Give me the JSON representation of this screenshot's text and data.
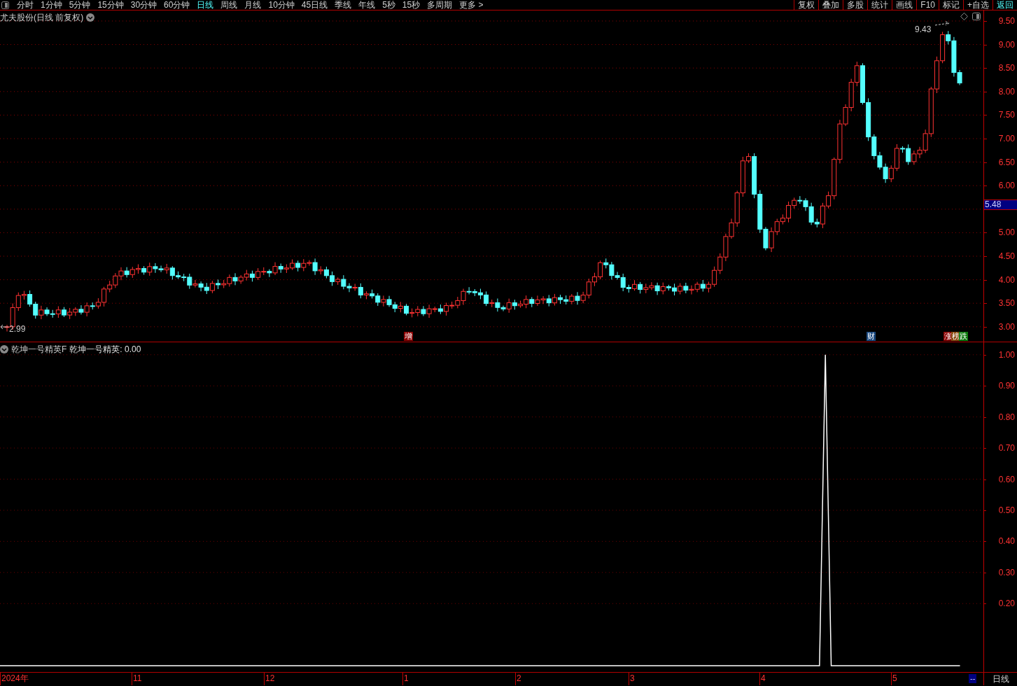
{
  "toolbar": {
    "periods": [
      {
        "label": "分时",
        "selected": false
      },
      {
        "label": "1分钟",
        "selected": false
      },
      {
        "label": "5分钟",
        "selected": false
      },
      {
        "label": "15分钟",
        "selected": false
      },
      {
        "label": "30分钟",
        "selected": false
      },
      {
        "label": "60分钟",
        "selected": false
      },
      {
        "label": "日线",
        "selected": true
      },
      {
        "label": "周线",
        "selected": false
      },
      {
        "label": "月线",
        "selected": false
      },
      {
        "label": "10分钟",
        "selected": false
      },
      {
        "label": "45日线",
        "selected": false
      },
      {
        "label": "季线",
        "selected": false
      },
      {
        "label": "年线",
        "selected": false
      },
      {
        "label": "5秒",
        "selected": false
      },
      {
        "label": "15秒",
        "selected": false
      },
      {
        "label": "多周期",
        "selected": false
      },
      {
        "label": "更多 >",
        "selected": false
      }
    ],
    "tools": [
      {
        "label": "复权",
        "selected": false
      },
      {
        "label": "叠加",
        "selected": false
      },
      {
        "label": "多股",
        "selected": false
      },
      {
        "label": "统计",
        "selected": false
      },
      {
        "label": "画线",
        "selected": false
      },
      {
        "label": "F10",
        "selected": false
      },
      {
        "label": "标记",
        "selected": false
      },
      {
        "label": "+自选",
        "selected": false
      },
      {
        "label": "返回",
        "selected": true
      }
    ]
  },
  "main_chart": {
    "title": "尤夫股份(日线 前复权)",
    "price_axis": [
      "9.50",
      "9.00",
      "8.50",
      "8.00",
      "7.50",
      "7.00",
      "6.50",
      "6.00",
      "5.00",
      "4.50",
      "4.00",
      "3.50",
      "3.00"
    ],
    "high_label": "9.43",
    "low_label": "2.99",
    "current_price": "5.48",
    "events": [
      {
        "text": "增",
        "color": "#8b0000"
      },
      {
        "text": "财",
        "color": "#1c4a80"
      },
      {
        "text": "涨",
        "color": "#8b0000"
      },
      {
        "text": "榜",
        "color": "#8b4a10"
      },
      {
        "text": "跌",
        "color": "#0e7a0e"
      }
    ]
  },
  "indicator": {
    "name": "乾坤一号精英F",
    "reading": ": 0.00",
    "chart_data": {
      "type": "line",
      "grid": true,
      "ylim": [
        -0.02,
        1.04
      ],
      "yticks": [
        {
          "value": 1,
          "label": "1.00"
        },
        {
          "value": 0.9,
          "label": "0.90"
        },
        {
          "value": 0.8,
          "label": "0.80"
        },
        {
          "value": 0.7,
          "label": "0.70"
        },
        {
          "value": 0.6,
          "label": "0.60"
        },
        {
          "value": 0.5,
          "label": "0.50"
        },
        {
          "value": 0.4,
          "label": "0.40"
        },
        {
          "value": 0.3,
          "label": "0.30"
        },
        {
          "value": 0.2,
          "label": "0.20"
        }
      ],
      "series": [
        {
          "name": "乾坤一号精英",
          "color": "#ffffff",
          "values": [
            0,
            0,
            0,
            0,
            0,
            0,
            0,
            0,
            0,
            0,
            0,
            0,
            0,
            0,
            0,
            0,
            0,
            0,
            0,
            0,
            0,
            0,
            0,
            0,
            0,
            0,
            0,
            0,
            0,
            0,
            0,
            0,
            0,
            0,
            0,
            0,
            0,
            0,
            0,
            0,
            0,
            0,
            0,
            0,
            0,
            0,
            0,
            0,
            0,
            0,
            0,
            0,
            0,
            0,
            0,
            0,
            0,
            0,
            0,
            0,
            0,
            0,
            0,
            0,
            0,
            0,
            0,
            0,
            0,
            0,
            0,
            0,
            0,
            0,
            0,
            0,
            0,
            0,
            0,
            0,
            0,
            0,
            0,
            0,
            0,
            0,
            0,
            0,
            0,
            0,
            0,
            0,
            0,
            0,
            0,
            0,
            0,
            0,
            0,
            0,
            0,
            0,
            0,
            0,
            0,
            0,
            0,
            0,
            0,
            0,
            0,
            0,
            0,
            0,
            0,
            0,
            0,
            0,
            0,
            0,
            0,
            0,
            0,
            0,
            0,
            0,
            0,
            0,
            0,
            0,
            0,
            0,
            0,
            0,
            0,
            0,
            0,
            0,
            0,
            0,
            0,
            1,
            0,
            0,
            0,
            0,
            0,
            0,
            0,
            0,
            0,
            0,
            0,
            0,
            0,
            0,
            0,
            0,
            0,
            0,
            0,
            0,
            0,
            0,
            0,
            null,
            null,
            null,
            null
          ]
        }
      ]
    }
  },
  "time_axis": {
    "labels": [
      "2024年",
      "11",
      "12",
      "1",
      "2",
      "3",
      "4",
      "5"
    ],
    "scroll_tag": "--",
    "period": "日线"
  }
}
